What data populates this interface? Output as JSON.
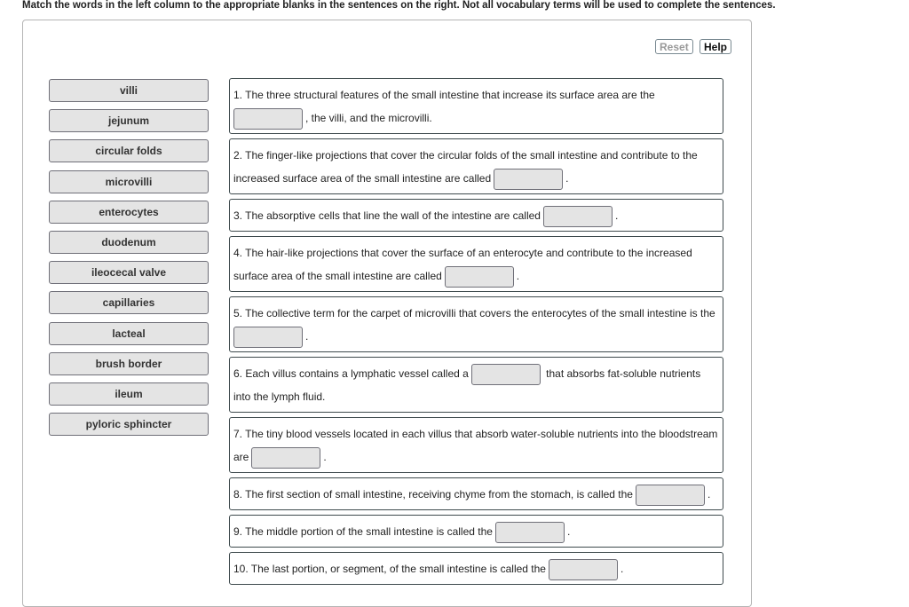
{
  "instructions": "Match the words in the left column to the appropriate blanks in the sentences on the right. Not all vocabulary terms will be used to complete the sentences.",
  "toolbar": {
    "reset_label": "Reset",
    "help_label": "Help"
  },
  "terms": [
    "villi",
    "jejunum",
    "circular folds",
    "microvilli",
    "enterocytes",
    "duodenum",
    "ileocecal valve",
    "capillaries",
    "lacteal",
    "brush border",
    "ileum",
    "pyloric sphincter"
  ],
  "sentences": [
    {
      "before": "1. The three structural features of the small intestine that increase its surface area are the",
      "after": ", the villi, and the microvilli."
    },
    {
      "before": "2. The finger-like projections that cover the circular folds of the small intestine and contribute to the increased surface area of the small intestine are called",
      "after": "."
    },
    {
      "before": "3. The absorptive cells that line the wall of the intestine are called",
      "after": "."
    },
    {
      "before": "4. The hair-like projections that cover the surface of an enterocyte and contribute to the increased surface area of the small intestine are called",
      "after": "."
    },
    {
      "before": "5. The collective term for the carpet of microvilli that covers the enterocytes of the small intestine is the",
      "after": "."
    },
    {
      "before": "6. Each villus contains a lymphatic vessel called a",
      "after": "that absorbs fat-soluble nutrients into the lymph fluid."
    },
    {
      "before": "7. The tiny blood vessels located in each villus that absorb water-soluble nutrients into the bloodstream are",
      "after": "."
    },
    {
      "before": "8. The first section of small intestine, receiving chyme from the stomach, is called the",
      "after": "."
    },
    {
      "before": "9. The middle portion of the small intestine is called the",
      "after": "."
    },
    {
      "before": "10. The last portion, or segment, of the small intestine is called the",
      "after": "."
    }
  ]
}
